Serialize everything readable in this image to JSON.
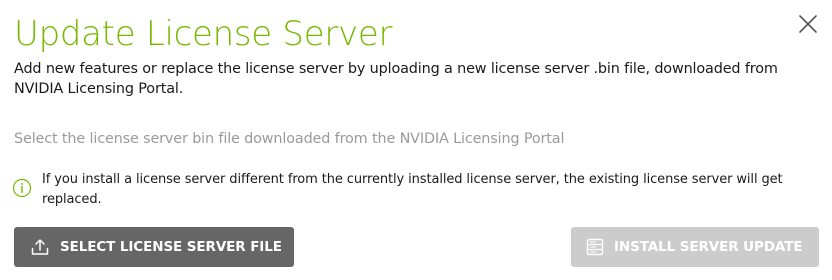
{
  "dialog": {
    "title": "Update License Server",
    "description": "Add new features or replace the license server by uploading a new license server .bin file, downloaded from NVIDIA Licensing Portal.",
    "file_hint": "Select the license server bin file downloaded from the NVIDIA Licensing Portal",
    "notice": {
      "icon": "info-icon",
      "text": "If you install a license server different from the currently installed license server, the existing license server will get replaced."
    },
    "close_icon": "close-icon"
  },
  "buttons": {
    "select_file": {
      "label": "SELECT LICENSE SERVER FILE",
      "icon": "upload-icon",
      "enabled": true
    },
    "install_update": {
      "label": "INSTALL SERVER UPDATE",
      "icon": "server-icon",
      "enabled": false
    }
  },
  "colors": {
    "title": "#76b900",
    "text": "#1a1a1a",
    "hint": "#9a9a9a",
    "primary_button": "#666666",
    "disabled_button": "#cccccc",
    "info_icon": "#76b900"
  }
}
